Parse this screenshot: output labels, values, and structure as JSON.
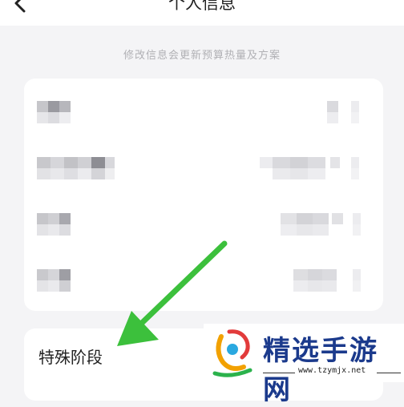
{
  "header": {
    "title": "个人信息",
    "back_icon": "chevron-left-icon"
  },
  "hint": "修改信息会更新预算热量及方案",
  "rows": [
    {
      "label": "",
      "value": ""
    },
    {
      "label": "",
      "value": ""
    },
    {
      "label": "",
      "value": ""
    },
    {
      "label": "",
      "value": ""
    }
  ],
  "special_stage": {
    "label": "特殊阶段"
  },
  "annotation": {
    "arrow_color": "#3cc03c"
  },
  "watermark": {
    "brand": "精选手游网",
    "url": "www.tzymjx.net"
  }
}
